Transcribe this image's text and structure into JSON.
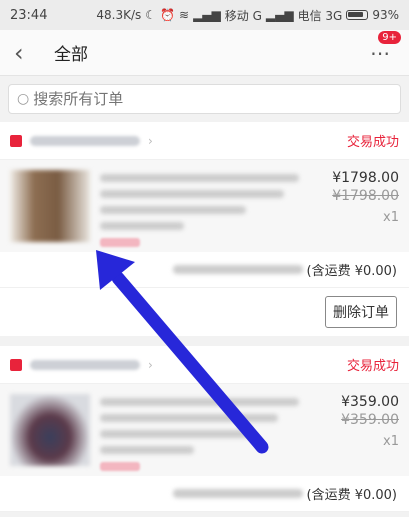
{
  "statusbar": {
    "time": "23:44",
    "speed": "48.3K/s",
    "carrier1": "移动 G",
    "carrier2": "电信 3G",
    "battery": "93%"
  },
  "header": {
    "back_icon": "chevron-left-icon",
    "title": "全部",
    "badge": "9+"
  },
  "search": {
    "placeholder": "搜索所有订单"
  },
  "orders": [
    {
      "status": "交易成功",
      "price": "¥1798.00",
      "orig_price": "¥1798.00",
      "qty": "x1",
      "freight": "(含运费 ¥0.00)",
      "action": "删除订单"
    },
    {
      "status": "交易成功",
      "price": "¥359.00",
      "orig_price": "¥359.00",
      "qty": "x1",
      "freight": "(含运费 ¥0.00)"
    }
  ],
  "colors": {
    "accent": "#e8233b",
    "annotation_arrow": "#2727d9"
  }
}
